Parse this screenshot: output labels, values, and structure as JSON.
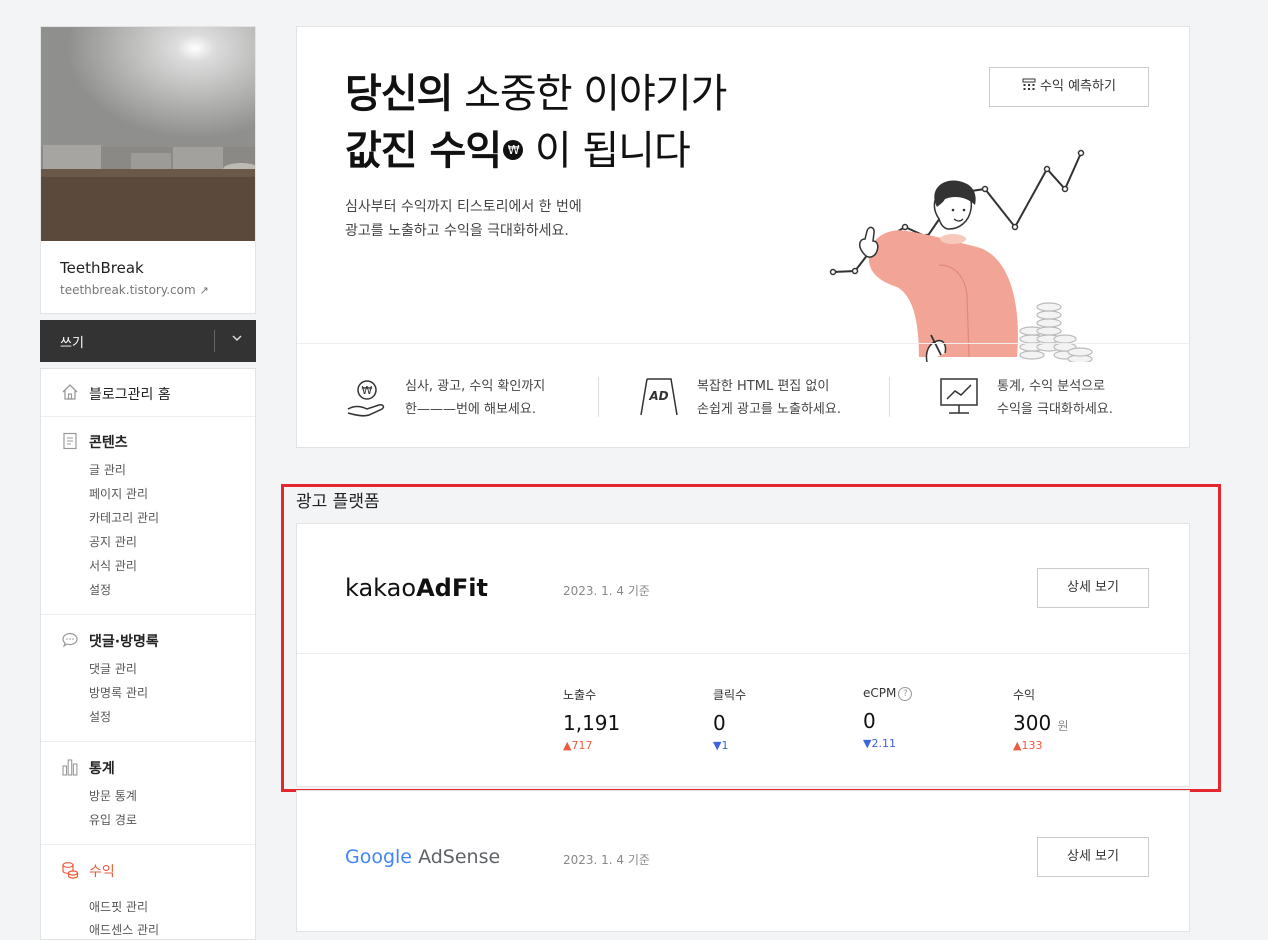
{
  "sidebar": {
    "blog_name": "TeethBreak",
    "blog_url": "teethbreak.tistory.com",
    "write_label": "쓰기",
    "menu": {
      "home": "블로그관리 홈",
      "content": {
        "title": "콘텐츠",
        "items": [
          "글 관리",
          "페이지 관리",
          "카테고리 관리",
          "공지 관리",
          "서식 관리",
          "설정"
        ]
      },
      "comments": {
        "title": "댓글·방명록",
        "items": [
          "댓글 관리",
          "방명록 관리",
          "설정"
        ]
      },
      "stats": {
        "title": "통계",
        "items": [
          "방문 통계",
          "유입 경로"
        ]
      },
      "earnings": {
        "title": "수익",
        "items": [
          "애드핏 관리",
          "애드센스 관리"
        ]
      }
    }
  },
  "hero": {
    "line1_bold": "당신의",
    "line1_rest": " 소중한 이야기가",
    "line2_bold": "값진 수익",
    "line2_rest": " 이 됩니다",
    "desc1": "심사부터 수익까지 티스토리에서 한 번에",
    "desc2": "광고를 노출하고 수익을 극대화하세요.",
    "predict_label": "수익 예측하기",
    "features": [
      {
        "line1": "심사, 광고, 수익 확인까지",
        "line2": "한———번에 해보세요."
      },
      {
        "line1": "복잡한 HTML 편집 없이",
        "line2": "손쉽게 광고를 노출하세요."
      },
      {
        "line1": "통계, 수익 분석으로",
        "line2": "수익을 극대화하세요."
      }
    ]
  },
  "platform": {
    "section_title": "광고 플랫폼",
    "adfit": {
      "logo_light": "kakao",
      "logo_bold": "AdFit",
      "date": "2023. 1. 4 기준",
      "detail_label": "상세 보기",
      "stats": [
        {
          "label": "노출수",
          "value": "1,191",
          "unit": "",
          "change": "717",
          "direction": "up"
        },
        {
          "label": "클릭수",
          "value": "0",
          "unit": "",
          "change": "1",
          "direction": "down"
        },
        {
          "label": "eCPM",
          "value": "0",
          "unit": "",
          "change": "2.11",
          "direction": "down"
        },
        {
          "label": "수익",
          "value": "300",
          "unit": "원",
          "change": "133",
          "direction": "up"
        }
      ]
    },
    "adsense": {
      "logo_google": "Google",
      "logo_product": "AdSense",
      "date": "2023. 1. 4 기준",
      "detail_label": "상세 보기"
    }
  },
  "colors": {
    "accent": "#eb5b3d",
    "down": "#3d64d8",
    "highlight_frame": "#e4262e"
  }
}
